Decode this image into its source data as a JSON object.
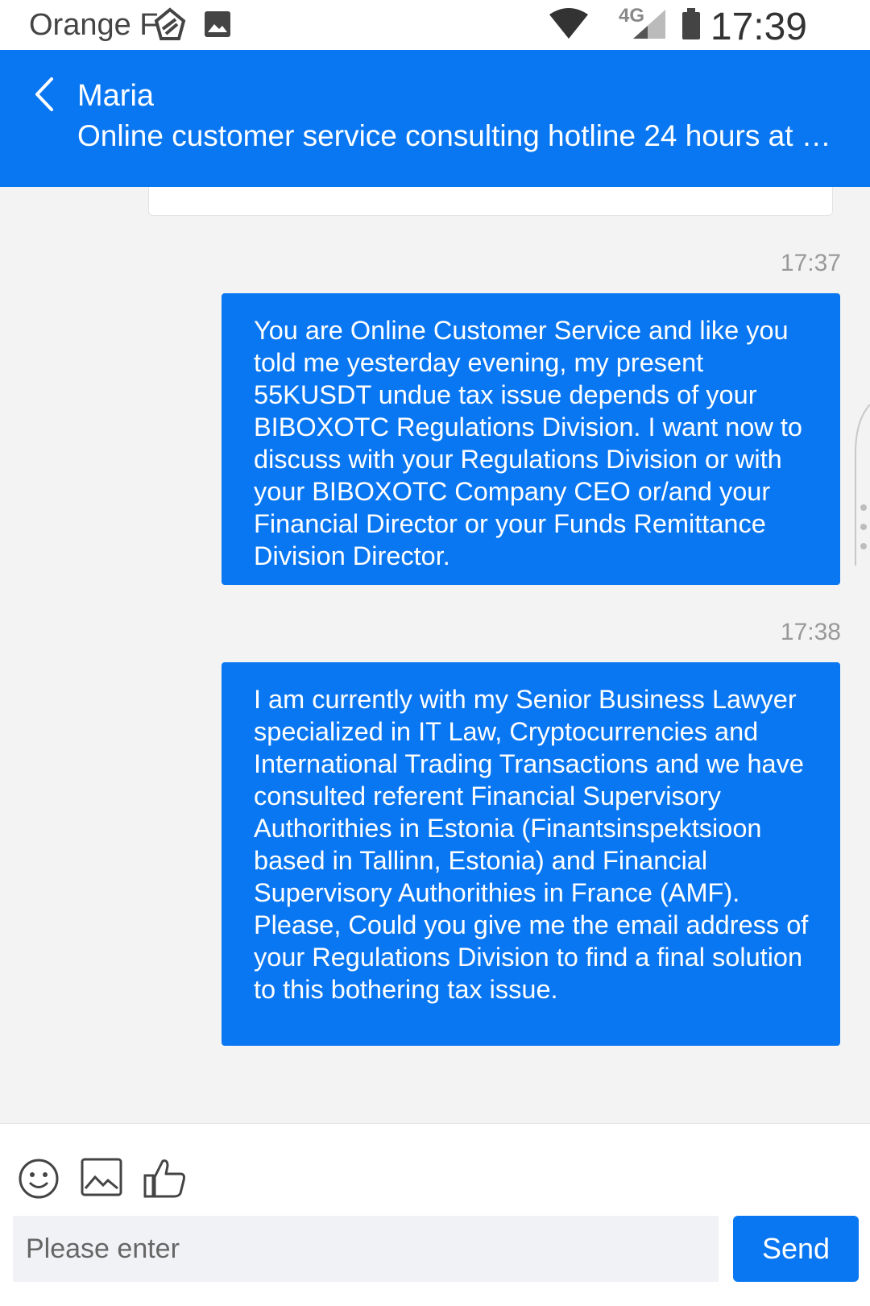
{
  "status_bar": {
    "carrier": "Orange F",
    "network": "4G",
    "time": "17:39"
  },
  "header": {
    "contact_name": "Maria",
    "subtitle": "Online customer service consulting hotline 24 hours at y..."
  },
  "messages": [
    {
      "time": "17:37",
      "text": "You are Online Customer Service and like you told me yesterday evening, my present 55KUSDT undue tax issue depends of your BIBOXOTC Regulations Division. I want now to discuss with your Regulations Division or with your BIBOXOTC Company CEO or/and your Financial Director or your Funds Remittance Division Director."
    },
    {
      "time": "17:38",
      "text": "I am currently with my Senior Business Lawyer specialized in IT Law, Cryptocurrencies and International Trading Transactions and we have consulted referent Financial Supervisory Authorithies in Estonia (Finantsinspektsioon based in Tallinn, Estonia) and Financial Supervisory Authorithies in France (AMF). Please, Could you give me the email address of your Regulations Division to find a final solution to this bothering tax issue."
    }
  ],
  "composer": {
    "placeholder": "Please enter",
    "send_label": "Send",
    "icons": [
      "emoji-icon",
      "image-icon",
      "thumbs-up-icon"
    ]
  },
  "colors": {
    "accent": "#0a77f2",
    "background": "#f3f3f3"
  }
}
